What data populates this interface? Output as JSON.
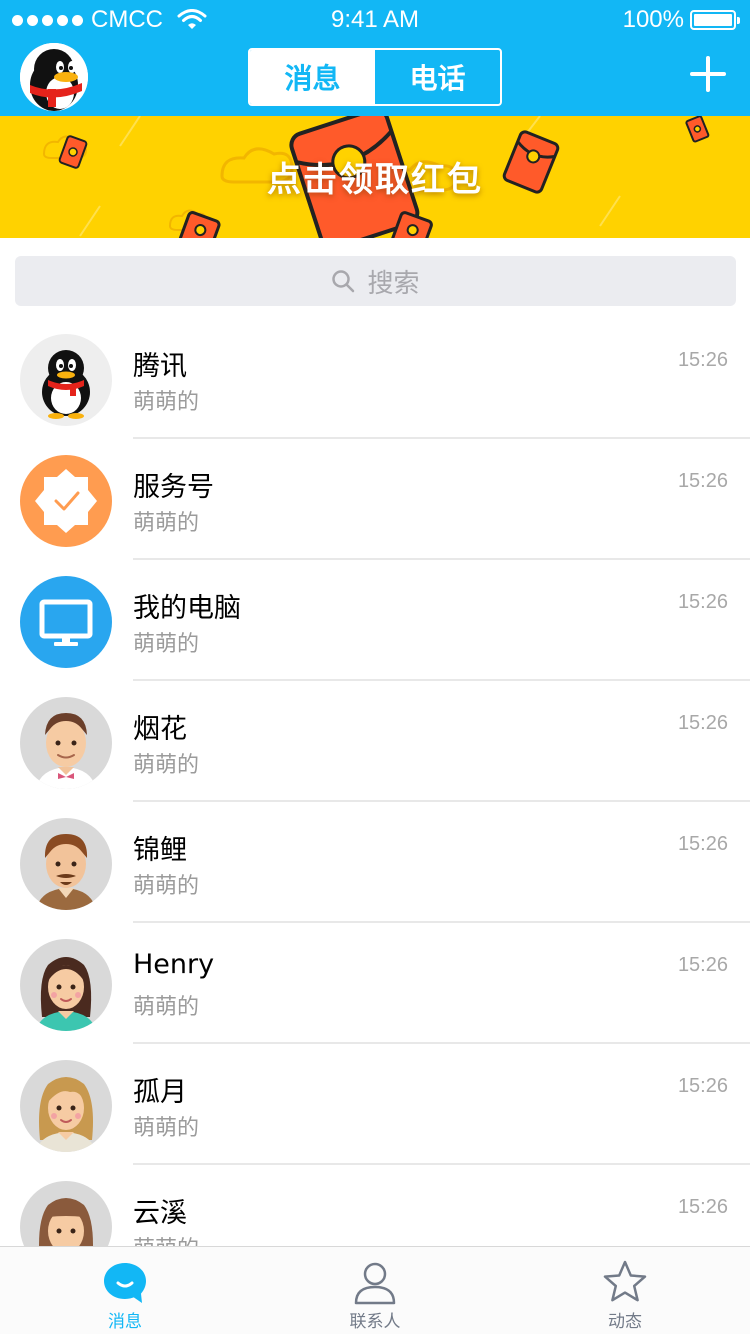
{
  "status_bar": {
    "carrier": "CMCC",
    "time": "9:41 AM",
    "battery": "100%"
  },
  "header": {
    "tabs": [
      {
        "label": "消息",
        "active": true
      },
      {
        "label": "电话",
        "active": false
      }
    ]
  },
  "banner": {
    "text": "点击领取红包"
  },
  "search": {
    "placeholder": "搜索"
  },
  "conversations": [
    {
      "name": "腾讯",
      "preview": "萌萌的",
      "time": "15:26",
      "avatar": "qq-penguin-icon"
    },
    {
      "name": "服务号",
      "preview": "萌萌的",
      "time": "15:26",
      "avatar": "service-badge-icon"
    },
    {
      "name": "我的电脑",
      "preview": "萌萌的",
      "time": "15:26",
      "avatar": "computer-monitor-icon"
    },
    {
      "name": "烟花",
      "preview": "萌萌的",
      "time": "15:26",
      "avatar": "man-avatar"
    },
    {
      "name": "锦鲤",
      "preview": "萌萌的",
      "time": "15:26",
      "avatar": "bearded-man-avatar"
    },
    {
      "name": "Henry",
      "preview": "萌萌的",
      "time": "15:26",
      "avatar": "woman-avatar"
    },
    {
      "name": "孤月",
      "preview": "萌萌的",
      "time": "15:26",
      "avatar": "blonde-woman-avatar"
    },
    {
      "name": "云溪",
      "preview": "萌萌的",
      "time": "15:26",
      "avatar": "girl-avatar"
    }
  ],
  "tabbar": [
    {
      "label": "消息",
      "icon": "message-bubble-icon",
      "active": true
    },
    {
      "label": "联系人",
      "icon": "contacts-person-icon",
      "active": false
    },
    {
      "label": "动态",
      "icon": "star-icon",
      "active": false
    }
  ],
  "colors": {
    "primary": "#12b7f5",
    "banner": "#ffd200",
    "red_packet": "#ff5a2a",
    "service_orange": "#ff9c50"
  }
}
